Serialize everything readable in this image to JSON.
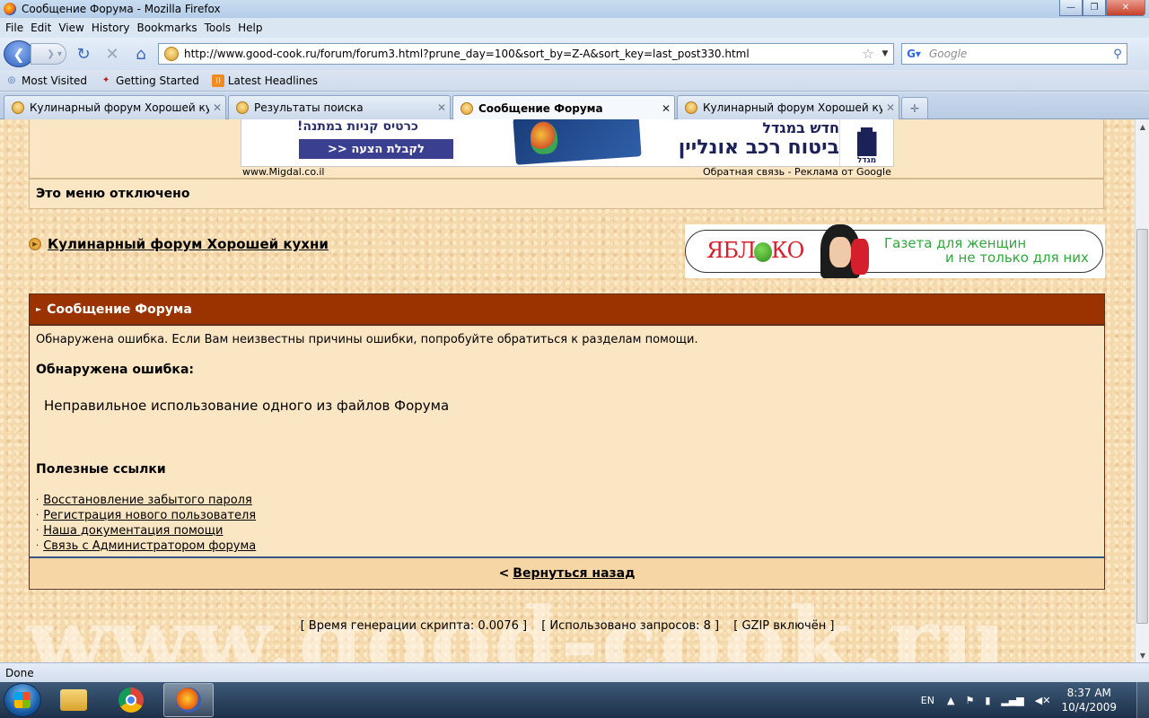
{
  "window": {
    "title": "Сообщение Форума - Mozilla Firefox",
    "controls": {
      "minimize": "—",
      "maximize": "❐",
      "close": "✕"
    }
  },
  "menu": [
    "File",
    "Edit",
    "View",
    "History",
    "Bookmarks",
    "Tools",
    "Help"
  ],
  "nav": {
    "url": "http://www.good-cook.ru/forum/forum3.html?prune_day=100&sort_by=Z-A&sort_key=last_post330.html",
    "search_placeholder": "Google"
  },
  "bookmarks": [
    "Most Visited",
    "Getting Started",
    "Latest Headlines"
  ],
  "tabs": [
    {
      "label": "Кулинарный форум Хорошей кух...",
      "active": false
    },
    {
      "label": "Результаты поиска",
      "active": false
    },
    {
      "label": "Сообщение Форума",
      "active": true
    },
    {
      "label": "Кулинарный форум Хорошей кух...",
      "active": false
    }
  ],
  "ad": {
    "heb_tagline": "כרטיס קניות במתנה!",
    "heb_button": "לקבלת הצעה <<",
    "heb_line1": "חדש במגדל",
    "heb_line2": "ביטוח רכב אונליין",
    "heb_logo": "מגדל",
    "source": "www.Migdal.co.il",
    "feedback": "Обратная связь - Реклама от Google"
  },
  "menu_disabled": "Это меню отключено",
  "forum_link": "Кулинарный форум Хорошей кухни",
  "yabloko": {
    "logo_a": "ЯБЛ",
    "logo_b": "КО",
    "line1": "Газета для женщин",
    "line2": "и не только для них"
  },
  "message": {
    "header": "Сообщение Форума",
    "intro": "Обнаружена ошибка. Если Вам неизвестны причины ошибки, попробуйте обратиться к разделам помощи.",
    "error_title": "Обнаружена ошибка:",
    "error_text": "Неправильное использование одного из файлов Форума",
    "links_title": "Полезные ссылки",
    "links": [
      "Восстановление забытого пароля",
      "Регистрация нового пользователя",
      "Наша документация помощи",
      "Связь с Администратором форума"
    ],
    "back_prefix": "<",
    "back": "Вернуться назад"
  },
  "stats": {
    "gen_time": "[ Время генерации скрипта: 0.0076 ]",
    "queries": "[ Использовано запросов: 8 ]",
    "gzip": "[ GZIP включён ]"
  },
  "watermark": "www.good-cook.ru",
  "status": "Done",
  "taskbar": {
    "lang": "EN",
    "time": "8:37 AM",
    "date": "10/4/2009"
  }
}
